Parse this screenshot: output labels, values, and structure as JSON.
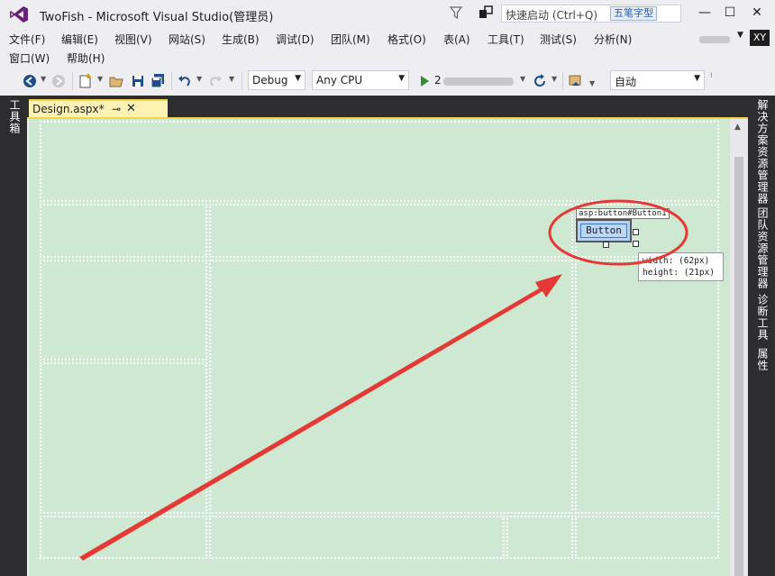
{
  "window": {
    "title": "TwoFish - Microsoft Visual Studio(管理员)",
    "quick_launch_placeholder": "快速启动 (Ctrl+Q)",
    "ime_label": "五笔字型",
    "controls": {
      "minimize": "—",
      "maximize": "☐",
      "close": "✕"
    }
  },
  "menu": {
    "row1": [
      "文件(F)",
      "编辑(E)",
      "视图(V)",
      "网站(S)",
      "生成(B)",
      "调试(D)",
      "团队(M)",
      "格式(O)",
      "表(A)",
      "工具(T)",
      "测试(S)",
      "分析(N)"
    ],
    "row2": [
      "窗口(W)",
      "帮助(H)"
    ],
    "user_initials": "XY"
  },
  "toolbar": {
    "config": "Debug",
    "platform": "Any CPU",
    "start_prefix": "2",
    "zoom": "自动"
  },
  "dock": {
    "left": [
      "工具箱"
    ],
    "right": [
      "解决方案资源管理器",
      "团队资源管理器",
      "诊断工具",
      "属性"
    ]
  },
  "document": {
    "tab_label": "Design.aspx*",
    "pin_glyph": "⊸",
    "close_glyph": "✕",
    "control_tag": "asp:button#Button1",
    "button_text": "Button",
    "size_width": "width: (62px)",
    "size_height": "height: (21px)"
  },
  "colors": {
    "canvas": "#cfe8d2",
    "dock_dark": "#2d2d30",
    "tab_active": "#fff2b3",
    "annotation_red": "#e53935"
  }
}
